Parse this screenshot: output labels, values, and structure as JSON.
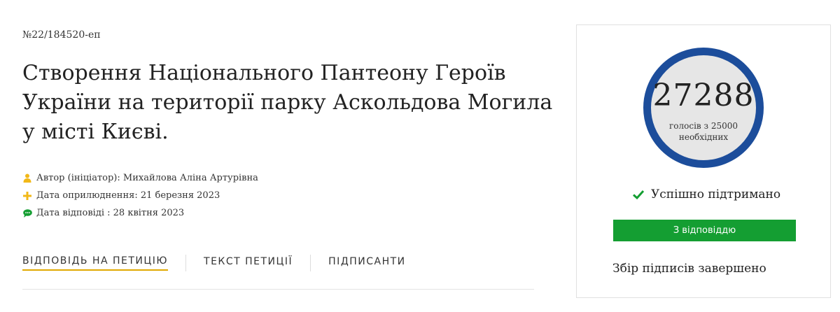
{
  "petition": {
    "number": "№22/184520-еп",
    "title": "Створення Національного Пантеону Героїв України на території парку Аскольдова Могила у місті Києві."
  },
  "meta": {
    "author": "Автор (ініціатор): Михайлова Аліна Артурівна",
    "published": "Дата оприлюднення: 21 березня 2023",
    "answered": "Дата відповіді : 28 квітня 2023",
    "icons": [
      "user-icon",
      "plus-icon",
      "comment-icon"
    ],
    "icon_colors": {
      "user": "#f2b818",
      "plus": "#f2b818",
      "comment": "#149e32"
    }
  },
  "tabs": [
    {
      "label": "ВІДПОВІДЬ НА ПЕТИЦІЮ",
      "active": true
    },
    {
      "label": "ТЕКСТ ПЕТИЦІЇ",
      "active": false
    },
    {
      "label": "ПІДПИСАНТИ",
      "active": false
    }
  ],
  "sidebar": {
    "votes": "27288",
    "votes_subtitle_line1": "голосів з 25000",
    "votes_subtitle_line2": "необхідних",
    "status": "Успішно підтримано",
    "answer_button": "З відповіддю",
    "collection_status": "Збір підписів завершено"
  },
  "colors": {
    "circle_ring": "#1c4d9b",
    "circle_fill": "#e6e6e6",
    "success_green": "#149e32",
    "tab_underline": "#e0a800"
  }
}
